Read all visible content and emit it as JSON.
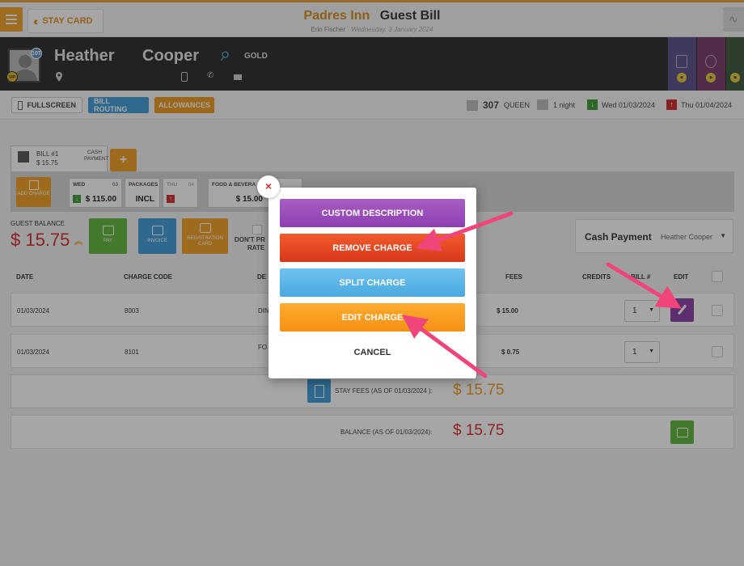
{
  "topbar": {
    "stay_card_label": "STAY CARD",
    "hotel_name": "Padres Inn",
    "page_title": "Guest Bill",
    "user_name": "Erin Fischer",
    "business_date": "Wednesday, 3 January 2024"
  },
  "guest": {
    "first_name": "Heather",
    "last_name": "Cooper",
    "tier": "GOLD",
    "id_badge": "10T",
    "vip_badge": "VIP"
  },
  "toolbar": {
    "fullscreen_label": "FULLSCREEN",
    "bill_routing_label": "BILL ROUTING",
    "allowances_label": "ALLOWANCES",
    "room_number": "307",
    "room_type": "QUEEN",
    "nights": "1 night",
    "arrival": "Wed 01/03/2024",
    "departure": "Thu 01/04/2024"
  },
  "bill": {
    "bill_label": "BILL #1",
    "bill_amount": "$ 15.75",
    "payment_type": "CASH PAYMENT",
    "add_bill_label": "+",
    "add_charge_label": "ADD CHARGE",
    "days": [
      {
        "label": "WED",
        "num": "03",
        "value": "$ 115.00"
      },
      {
        "label": "PACKAGES",
        "num": "",
        "value": "INCL"
      },
      {
        "label": "THU",
        "num": "04",
        "value": ""
      },
      {
        "label": "FOOD & BEVERA",
        "num": "",
        "value": "$ 15.00"
      }
    ]
  },
  "balance": {
    "guest_balance_label": "GUEST BALANCE",
    "guest_balance_value": "$ 15.75",
    "pay_label": "PAY",
    "invoice_label": "INVOICE",
    "registration_label": "REGISTRATION CARD",
    "dont_print_label": "DON'T PR",
    "dont_print_label2": "RATE",
    "payment_method": "Cash Payment",
    "payment_owner": "Heather Cooper"
  },
  "table": {
    "headers": {
      "date": "DATE",
      "charge_code": "CHARGE CODE",
      "description": "DE",
      "fees": "FEES",
      "credits": "CREDITS",
      "bill_no": "BILL #",
      "edit": "EDIT"
    },
    "rows": [
      {
        "date": "01/03/2024",
        "charge_code": "8003",
        "description": "DIN",
        "fees": "$ 15.00",
        "bill": "1"
      },
      {
        "date": "01/03/2024",
        "charge_code": "8101",
        "description": "FO",
        "fees": "$ 0.75",
        "bill": "1"
      }
    ]
  },
  "summary": {
    "stay_fees_label": "STAY FEES (AS OF  01/03/2024 ):",
    "stay_fees_value": "$ 15.75",
    "balance_label": "BALANCE (AS OF  01/03/2024):",
    "balance_value": "$ 15.75"
  },
  "modal": {
    "close_glyph": "×",
    "custom_description": "CUSTOM DESCRIPTION",
    "remove_charge": "REMOVE CHARGE",
    "split_charge": "SPLIT CHARGE",
    "edit_charge": "EDIT CHARGE",
    "cancel": "CANCEL"
  },
  "colors": {
    "accent_orange": "#f29f23",
    "accent_blue": "#3e9bd8",
    "accent_purple": "#8b3fa6",
    "balance_red": "#d62b2b",
    "arrow_pink": "#f0457a"
  }
}
